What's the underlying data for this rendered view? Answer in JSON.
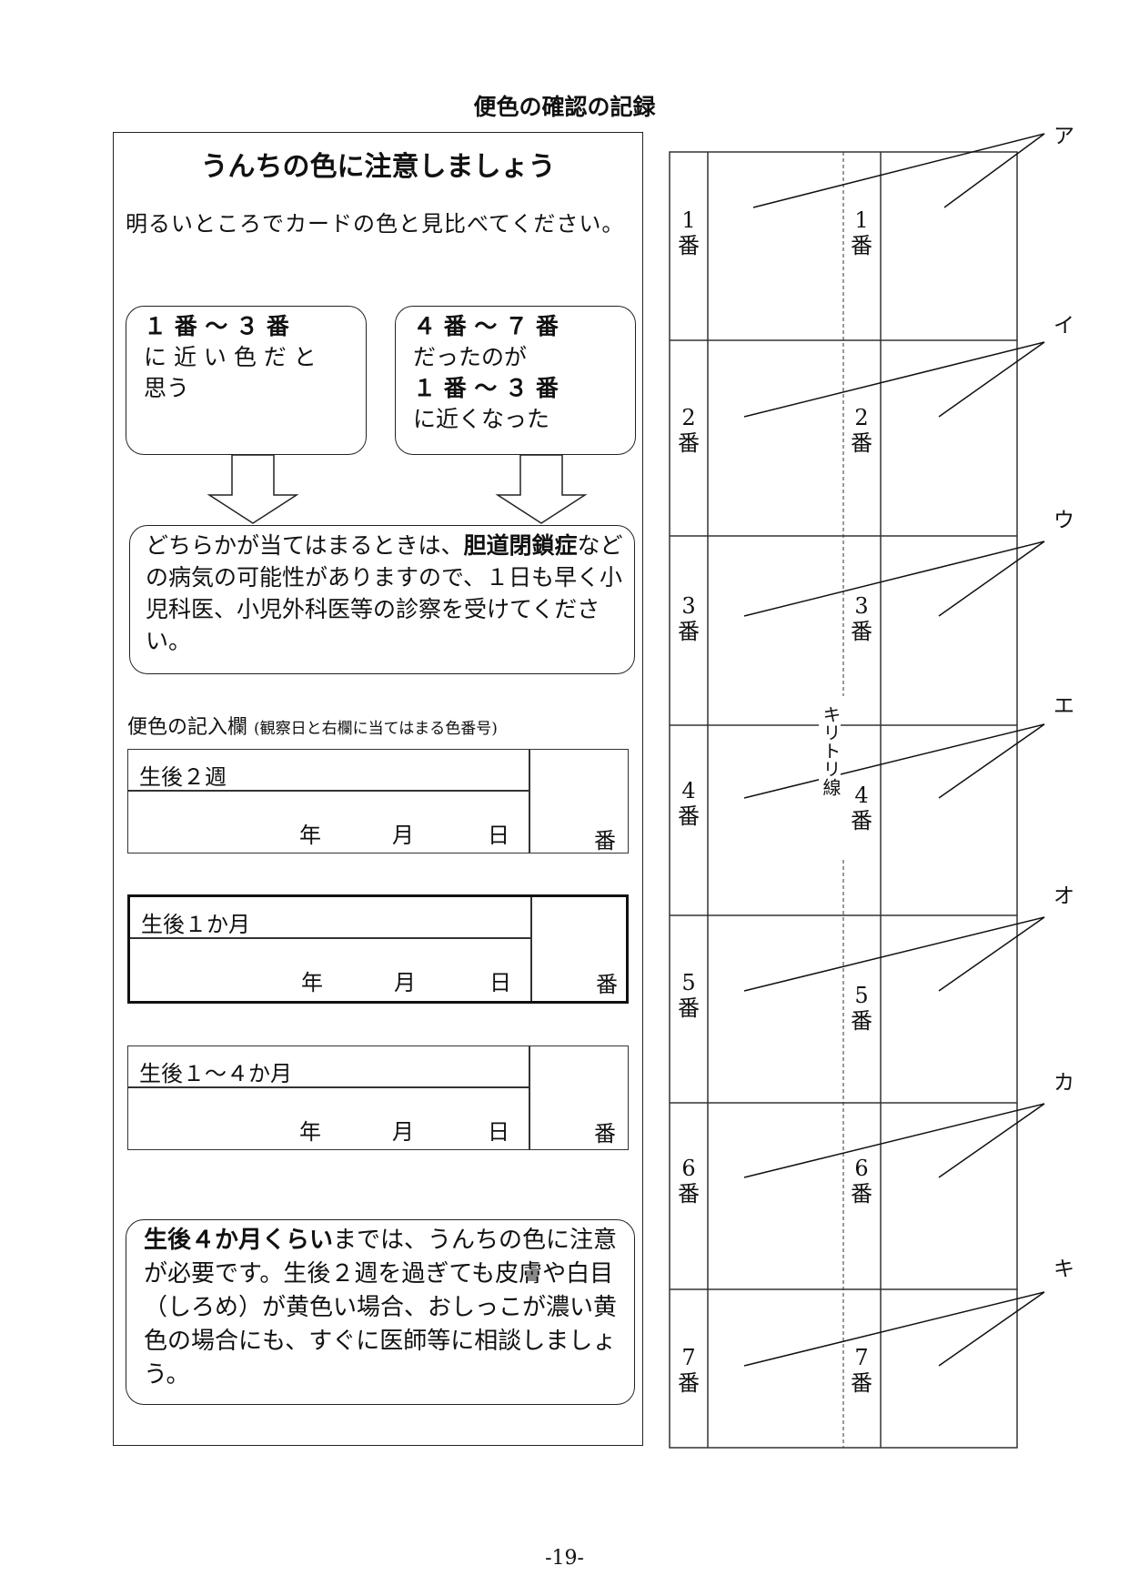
{
  "page_title": "便色の確認の記録",
  "panel_heading": "うんちの色に注意しましょう",
  "intro": "明るいところでカードの色と見比べてください。",
  "box_a": {
    "line1": "１ 番 ～ ３ 番",
    "line2": "に 近 い 色 だ と",
    "line3": "思う"
  },
  "box_b": {
    "line1": "４ 番 ～ ７ 番",
    "line2": "だったのが",
    "line3": "１ 番 ～ ３ 番",
    "line4": "に近くなった"
  },
  "warning": {
    "part1": "どちらかが当てはまるときは、",
    "bold": "胆道閉鎖症",
    "part2": "などの病気の可能性がありますので、１日も早く小児科医、小児外科医等の診察を受けてください。"
  },
  "log_label": "便色の記入欄",
  "log_label_note": "(観察日と右欄に当てはまる色番号)",
  "log_rows": [
    {
      "title": "生後２週",
      "year": "年",
      "month": "月",
      "day": "日",
      "number": "番"
    },
    {
      "title": "生後１か月",
      "year": "年",
      "month": "月",
      "day": "日",
      "number": "番"
    },
    {
      "title": "生後１～４か月",
      "year": "年",
      "month": "月",
      "day": "日",
      "number": "番"
    }
  ],
  "note": {
    "bold": "生後４か月くらい",
    "text": "までは、うんちの色に注意が必要です。生後２週を過ぎても皮膚や白目（しろめ）が黄色い場合、おしっこが濃い黄色の場合にも、すぐに医師等に相談しましょう。"
  },
  "color_card": {
    "labels": [
      "ア",
      "イ",
      "ウ",
      "エ",
      "オ",
      "カ",
      "キ"
    ],
    "numbers": [
      "1",
      "2",
      "3",
      "4",
      "5",
      "6",
      "7"
    ],
    "ban": "番",
    "cut_line": "キリトリ線"
  },
  "page_number": "-19-"
}
